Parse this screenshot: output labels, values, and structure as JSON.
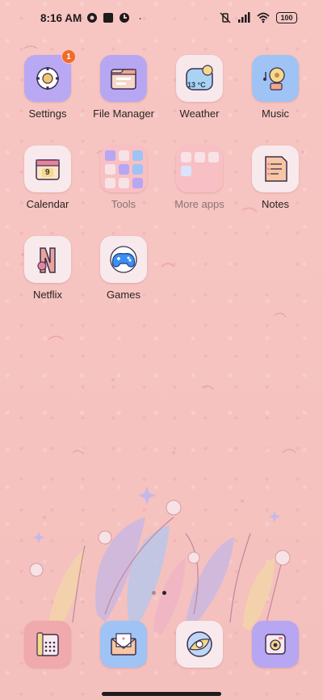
{
  "status_bar": {
    "time": "8:16 AM",
    "battery": "100"
  },
  "apps": [
    {
      "label": "Settings",
      "badge": "1"
    },
    {
      "label": "File Manager"
    },
    {
      "label": "Weather",
      "temp": "13 °C"
    },
    {
      "label": "Music"
    },
    {
      "label": "Calendar",
      "day": "9"
    },
    {
      "label": "Tools"
    },
    {
      "label": "More apps"
    },
    {
      "label": "Notes"
    },
    {
      "label": "Netflix"
    },
    {
      "label": "Games"
    }
  ],
  "dock": [
    {
      "icon": "phone-icon"
    },
    {
      "icon": "messages-icon"
    },
    {
      "icon": "browser-icon"
    },
    {
      "icon": "camera-icon"
    }
  ],
  "colors": {
    "wallpaper": "#f6c4c1",
    "badge": "#f06b2a",
    "purple_tile": "#b6a6f3",
    "blue_tile": "#9fc3f5"
  }
}
